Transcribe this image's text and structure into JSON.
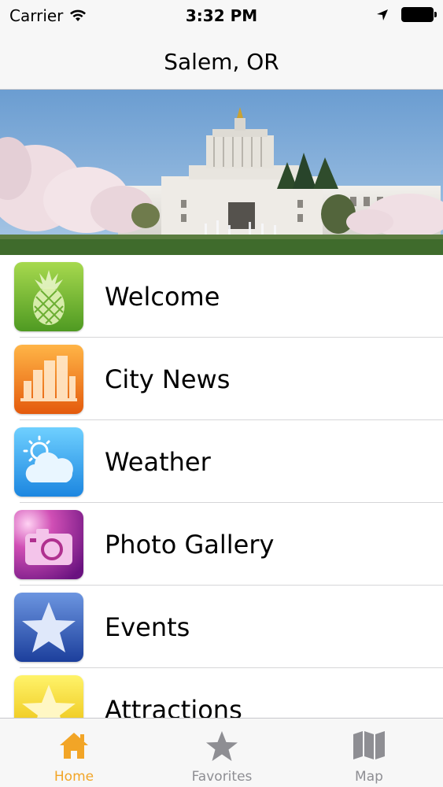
{
  "status_bar": {
    "carrier": "Carrier",
    "time": "3:32 PM"
  },
  "nav": {
    "title": "Salem, OR"
  },
  "menu": {
    "items": [
      {
        "label": "Welcome",
        "icon": "pineapple-icon"
      },
      {
        "label": "City News",
        "icon": "buildings-icon"
      },
      {
        "label": "Weather",
        "icon": "cloud-sun-icon"
      },
      {
        "label": "Photo Gallery",
        "icon": "camera-icon"
      },
      {
        "label": "Events",
        "icon": "star-icon"
      },
      {
        "label": "Attractions",
        "icon": "star-icon"
      }
    ]
  },
  "tabs": {
    "items": [
      {
        "label": "Home",
        "icon": "home-icon",
        "selected": true
      },
      {
        "label": "Favorites",
        "icon": "star-icon",
        "selected": false
      },
      {
        "label": "Map",
        "icon": "map-icon",
        "selected": false
      }
    ],
    "active_color": "#f2a527",
    "inactive_color": "#8e8e93"
  }
}
